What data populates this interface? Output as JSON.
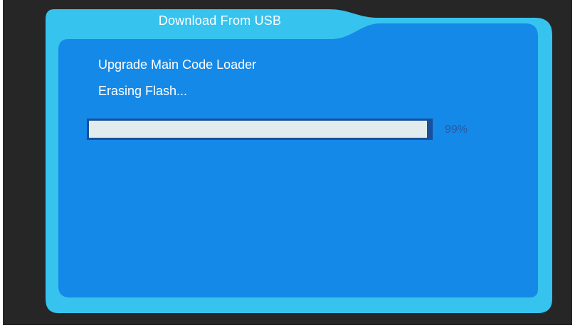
{
  "dialog": {
    "title": "Download From USB",
    "line1": "Upgrade Main Code Loader",
    "line2": "Erasing Flash...",
    "progress_label": "99%",
    "progress_fraction": 0.99
  },
  "colors": {
    "background": "#262626",
    "frame_outer": "#36c3ee",
    "panel": "#1589e8",
    "progress_border": "#1a4f9a",
    "progress_fill": "#e2ebee",
    "progress_text": "#2a5aa0"
  }
}
